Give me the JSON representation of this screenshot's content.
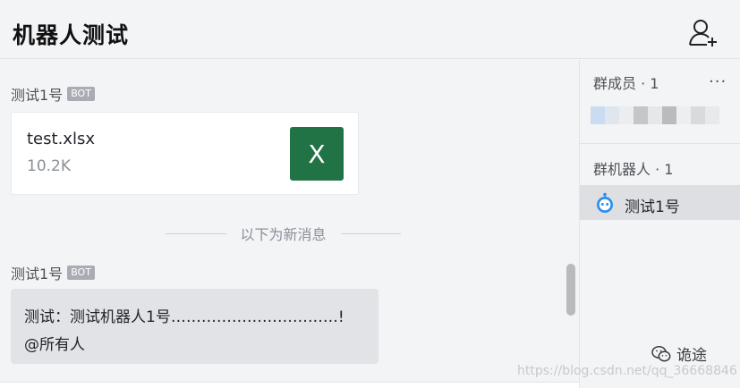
{
  "header": {
    "title": "机器人测试",
    "add_member_icon": "add-user-icon"
  },
  "chat": {
    "messages": [
      {
        "sender": "测试1号",
        "badge": "BOT",
        "file": {
          "name": "test.xlsx",
          "size": "10.2K",
          "icon_text": "X",
          "icon_color": "#217346"
        }
      },
      {
        "sender": "测试1号",
        "badge": "BOT",
        "lines": [
          "测试：测试机器人1号……………………………!",
          "@所有人"
        ]
      }
    ],
    "divider_text": "以下为新消息"
  },
  "sidebar": {
    "members_heading": "群成员 · 1",
    "more_icon": "more-icon",
    "bots_heading": "群机器人 · 1",
    "bots": [
      {
        "name": "测试1号",
        "icon": "robot-icon",
        "icon_color": "#2b8ef0"
      }
    ]
  },
  "watermark": {
    "text": "https://blog.csdn.net/qq_36668846",
    "wechat_label": "诡途"
  }
}
